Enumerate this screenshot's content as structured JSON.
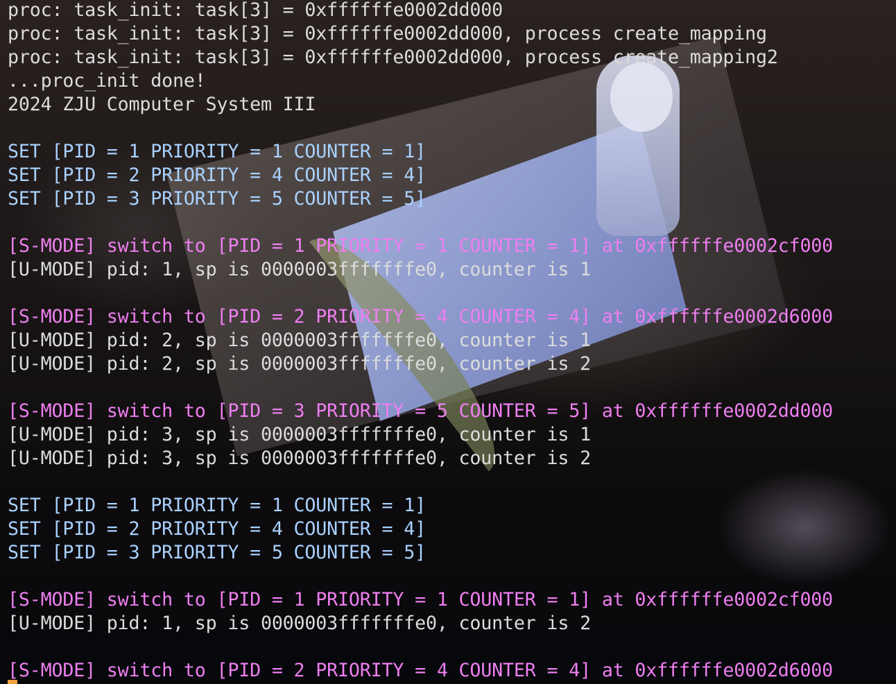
{
  "colors": {
    "normal_text": "#dcdcdc",
    "set_text": "#a9d1ff",
    "smode_text": "#ee7ff0",
    "cursor": "#f0a040"
  },
  "lines": [
    {
      "text": "proc: task_init: task[3] = 0xffffffe0002dd000",
      "style": "normal"
    },
    {
      "text": "proc: task_init: task[3] = 0xffffffe0002dd000, process create_mapping",
      "style": "normal"
    },
    {
      "text": "proc: task_init: task[3] = 0xffffffe0002dd000, process create_mapping2",
      "style": "normal"
    },
    {
      "text": "...proc_init done!",
      "style": "normal"
    },
    {
      "text": "2024 ZJU Computer System III",
      "style": "normal"
    },
    {
      "text": "",
      "style": "normal"
    },
    {
      "text": "SET [PID = 1 PRIORITY = 1 COUNTER = 1]",
      "style": "set"
    },
    {
      "text": "SET [PID = 2 PRIORITY = 4 COUNTER = 4]",
      "style": "set"
    },
    {
      "text": "SET [PID = 3 PRIORITY = 5 COUNTER = 5]",
      "style": "set"
    },
    {
      "text": "",
      "style": "normal"
    },
    {
      "text": "[S-MODE] switch to [PID = 1 PRIORITY = 1 COUNTER = 1] at 0xffffffe0002cf000",
      "style": "smode"
    },
    {
      "text": "[U-MODE] pid: 1, sp is 0000003fffffffe0, counter is 1",
      "style": "normal"
    },
    {
      "text": "",
      "style": "normal"
    },
    {
      "text": "[S-MODE] switch to [PID = 2 PRIORITY = 4 COUNTER = 4] at 0xffffffe0002d6000",
      "style": "smode"
    },
    {
      "text": "[U-MODE] pid: 2, sp is 0000003fffffffe0, counter is 1",
      "style": "normal"
    },
    {
      "text": "[U-MODE] pid: 2, sp is 0000003fffffffe0, counter is 2",
      "style": "normal"
    },
    {
      "text": "",
      "style": "normal"
    },
    {
      "text": "[S-MODE] switch to [PID = 3 PRIORITY = 5 COUNTER = 5] at 0xffffffe0002dd000",
      "style": "smode"
    },
    {
      "text": "[U-MODE] pid: 3, sp is 0000003fffffffe0, counter is 1",
      "style": "normal"
    },
    {
      "text": "[U-MODE] pid: 3, sp is 0000003fffffffe0, counter is 2",
      "style": "normal"
    },
    {
      "text": "",
      "style": "normal"
    },
    {
      "text": "SET [PID = 1 PRIORITY = 1 COUNTER = 1]",
      "style": "set"
    },
    {
      "text": "SET [PID = 2 PRIORITY = 4 COUNTER = 4]",
      "style": "set"
    },
    {
      "text": "SET [PID = 3 PRIORITY = 5 COUNTER = 5]",
      "style": "set"
    },
    {
      "text": "",
      "style": "normal"
    },
    {
      "text": "[S-MODE] switch to [PID = 1 PRIORITY = 1 COUNTER = 1] at 0xffffffe0002cf000",
      "style": "smode"
    },
    {
      "text": "[U-MODE] pid: 1, sp is 0000003fffffffe0, counter is 2",
      "style": "normal"
    },
    {
      "text": "",
      "style": "normal"
    },
    {
      "text": "[S-MODE] switch to [PID = 2 PRIORITY = 4 COUNTER = 4] at 0xffffffe0002d6000",
      "style": "smode"
    }
  ]
}
